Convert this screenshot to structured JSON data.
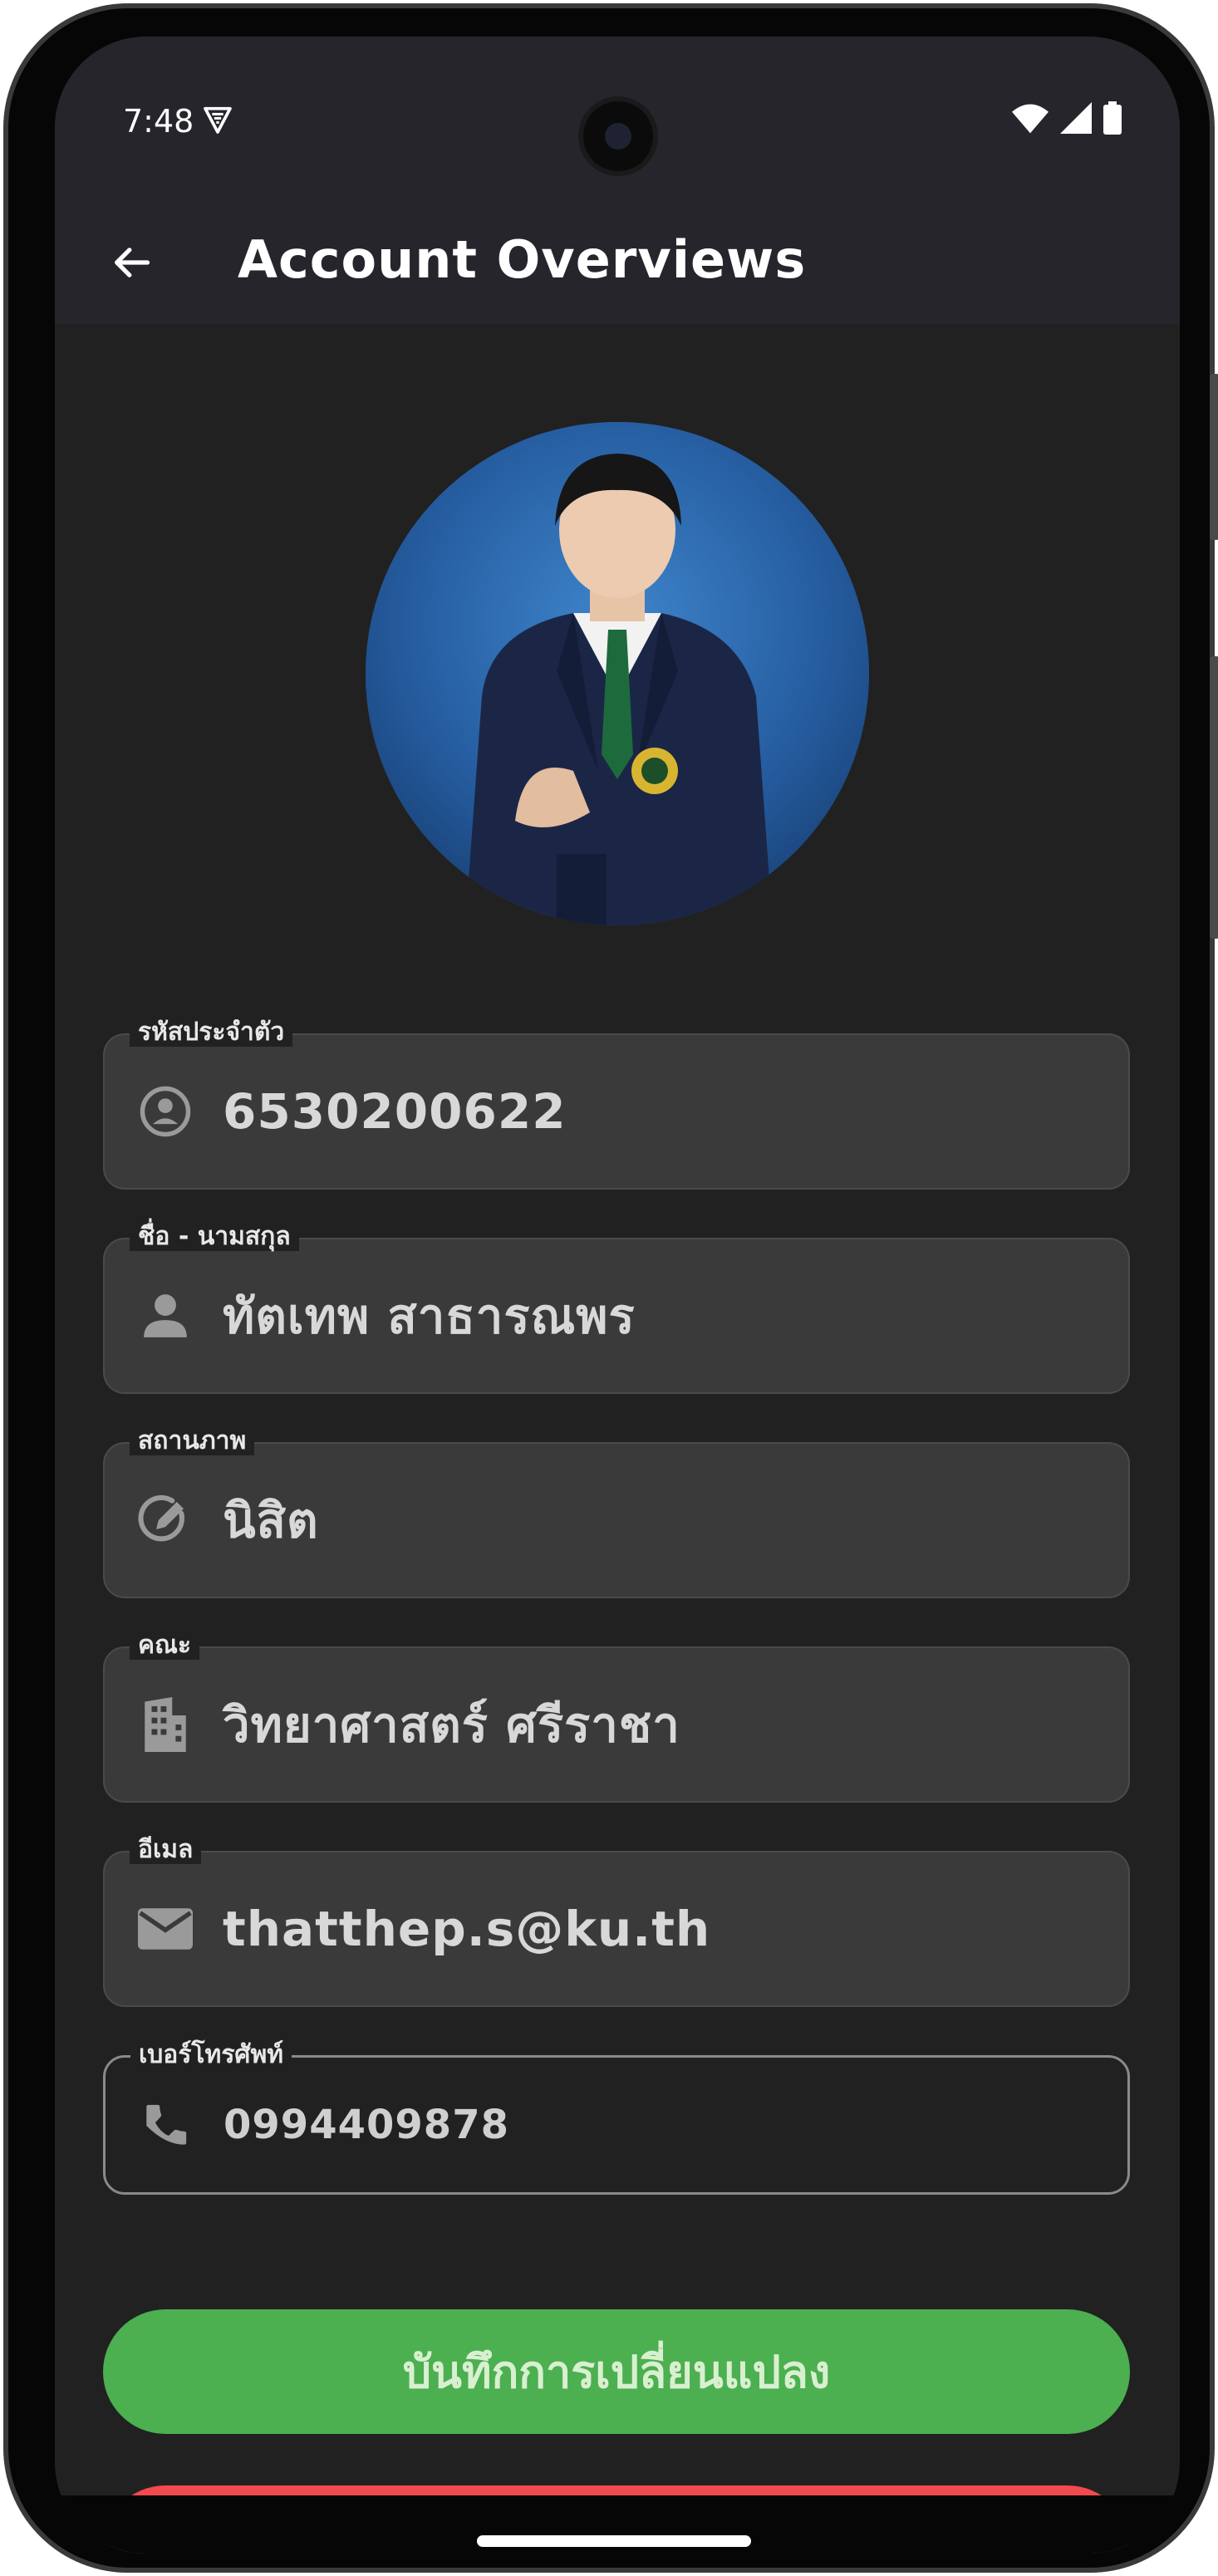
{
  "status_bar": {
    "time": "7:48"
  },
  "app_bar": {
    "title": "Account Overviews"
  },
  "fields": [
    {
      "label": "รหัสประจำตัว",
      "value": "6530200622",
      "icon": "account-circle-icon"
    },
    {
      "label": "ชื่อ - นามสกุล",
      "value": "ทัตเทพ สาธารณพร",
      "icon": "person-icon"
    },
    {
      "label": "สถานภาพ",
      "value": "นิสิต",
      "icon": "edit-status-icon"
    },
    {
      "label": "คณะ",
      "value": "วิทยาศาสตร์ ศรีราชา",
      "icon": "building-icon"
    },
    {
      "label": "อีเมล",
      "value": "thatthep.s@ku.th",
      "icon": "email-icon"
    },
    {
      "label": "เบอร์โทรศัพท์",
      "value": "0994409878",
      "icon": "phone-icon"
    }
  ],
  "actions": {
    "save_label": "บันทึกการเปลี่ยนแปลง"
  },
  "colors": {
    "accent_green": "#4caf50",
    "accent_red": "#f24a4e",
    "appbar": "#26252c",
    "background": "#212121"
  }
}
